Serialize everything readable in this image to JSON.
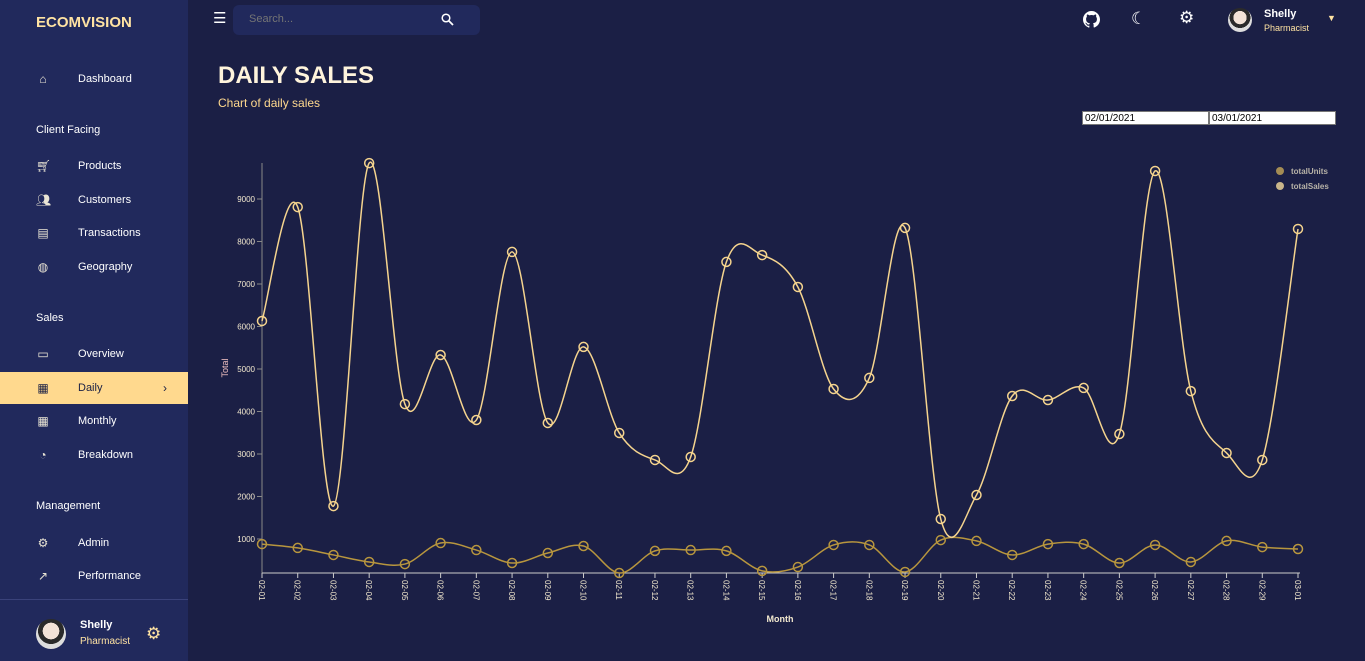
{
  "app": {
    "logo": "ECOMVISION"
  },
  "sidebar": {
    "items": [
      {
        "label": "Dashboard",
        "icon": "home-icon"
      },
      {
        "section": "Client Facing"
      },
      {
        "label": "Products",
        "icon": "shopping-cart-icon"
      },
      {
        "label": "Customers",
        "icon": "groups-icon"
      },
      {
        "label": "Transactions",
        "icon": "receipt-icon"
      },
      {
        "label": "Geography",
        "icon": "globe-icon"
      },
      {
        "section": "Sales"
      },
      {
        "label": "Overview",
        "icon": "point-of-sale-icon"
      },
      {
        "label": "Daily",
        "icon": "calendar-today-icon",
        "active": true
      },
      {
        "label": "Monthly",
        "icon": "calendar-month-icon"
      },
      {
        "label": "Breakdown",
        "icon": "pie-chart-icon"
      },
      {
        "section": "Management"
      },
      {
        "label": "Admin",
        "icon": "admin-icon"
      },
      {
        "label": "Performance",
        "icon": "trending-up-icon"
      }
    ],
    "user": {
      "name": "Shelly",
      "role": "Pharmacist"
    }
  },
  "topbar": {
    "search_placeholder": "Search...",
    "user": {
      "name": "Shelly",
      "role": "Pharmacist"
    }
  },
  "page": {
    "title": "DAILY SALES",
    "subtitle": "Chart of daily sales",
    "start_date": "02/01/2021",
    "end_date": "03/01/2021"
  },
  "colors": {
    "accent": "#ffd98e",
    "totalSales": "#f5d48e",
    "totalUnits": "#b8963e",
    "bg": "#1b1f45",
    "sidebar": "#21295c"
  },
  "chart_data": {
    "type": "line",
    "xlabel": "Month",
    "ylabel": "Total",
    "categories": [
      "02-01",
      "02-02",
      "02-03",
      "02-04",
      "02-05",
      "02-06",
      "02-07",
      "02-08",
      "02-09",
      "02-10",
      "02-11",
      "02-12",
      "02-13",
      "02-14",
      "02-15",
      "02-16",
      "02-17",
      "02-18",
      "02-19",
      "02-20",
      "02-21",
      "02-22",
      "02-23",
      "02-24",
      "02-25",
      "02-26",
      "02-27",
      "02-28",
      "02-29",
      "03-01"
    ],
    "yticks": [
      1000,
      2000,
      3000,
      4000,
      5000,
      6000,
      7000,
      8000,
      9000
    ],
    "ylim": [
      200,
      9850
    ],
    "legend": "top-right",
    "series": [
      {
        "name": "totalUnits",
        "color": "#b8963e",
        "legend_color": "#a48c54",
        "values": [
          880,
          790,
          625,
          460,
          410,
          905,
          740,
          435,
          670,
          835,
          200,
          720,
          740,
          720,
          250,
          340,
          860,
          860,
          225,
          975,
          955,
          625,
          880,
          880,
          435,
          860,
          460,
          955,
          810,
          765
        ]
      },
      {
        "name": "totalSales",
        "color": "#f5d48e",
        "legend_color": "#c9b58a",
        "values": [
          6130,
          8810,
          1775,
          9845,
          4175,
          5330,
          3800,
          7755,
          3730,
          5520,
          3495,
          2860,
          2930,
          7520,
          7680,
          6930,
          4530,
          4790,
          8320,
          1470,
          2035,
          4365,
          4270,
          4555,
          3470,
          9660,
          4480,
          3025,
          2860,
          8295
        ]
      }
    ]
  }
}
